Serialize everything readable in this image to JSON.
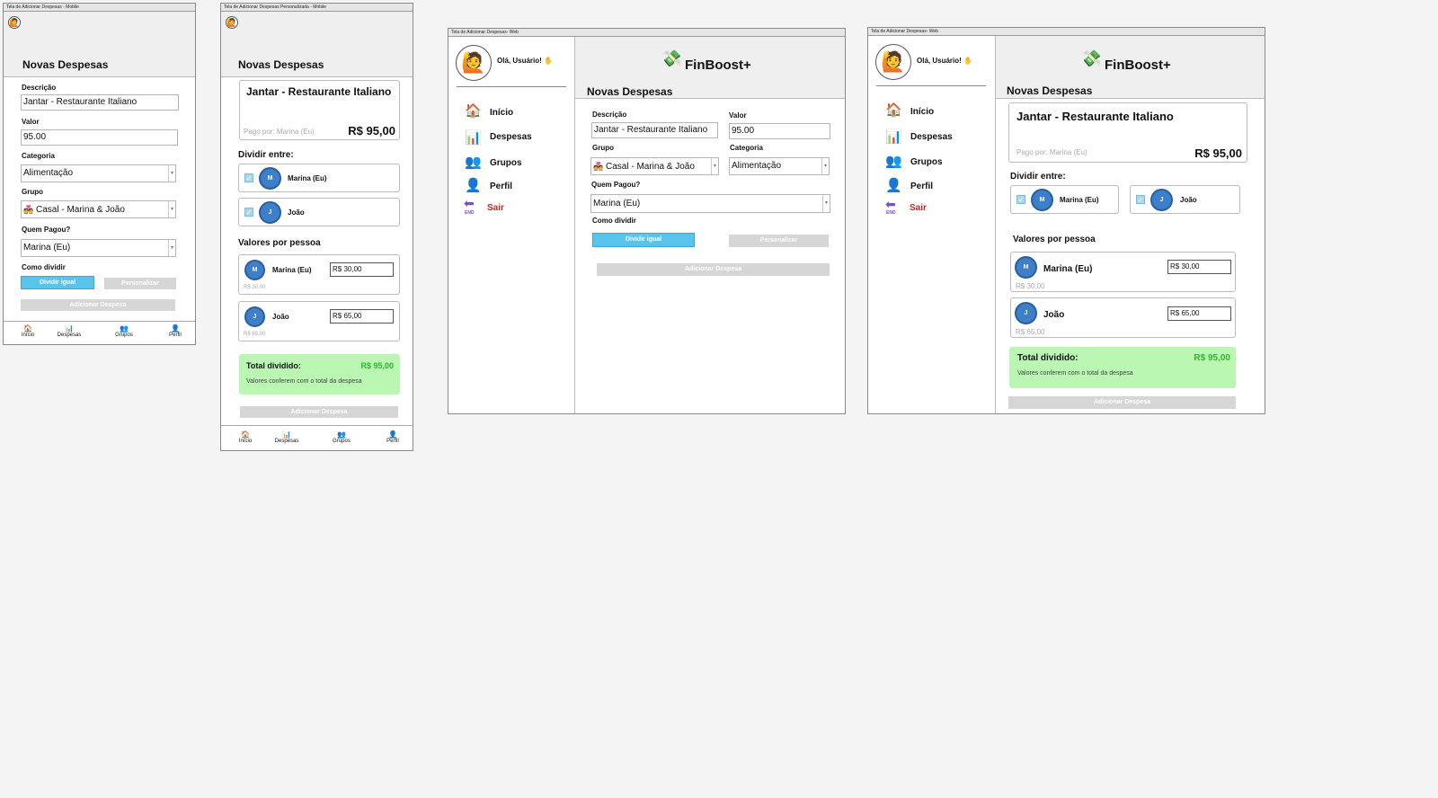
{
  "brand": {
    "name": "FinBoost+",
    "logo_icon": "money-hand-icon",
    "accent": "#58c4ec",
    "danger": "#cc2222",
    "success_bg": "#b9f7b2",
    "success_text": "#2fb52f"
  },
  "common": {
    "page_title": "Novas Despesas",
    "greeting": "Olá, Usuário! ✋",
    "label_descricao": "Descrição",
    "label_valor": "Valor",
    "label_categoria": "Categoria",
    "label_grupo": "Grupo",
    "label_quem_pagou": "Quem Pagou?",
    "label_como_dividir": "Como dividir",
    "value_descricao": "Jantar - Restaurante Italiano",
    "value_valor": "95.00",
    "value_categoria": "Alimentação",
    "value_grupo": "Casal - Marina & João",
    "value_quem_pagou": "Marina (Eu)",
    "btn_dividir_igual": "Dividir igual",
    "btn_personalizar": "Personalizar",
    "btn_adicionar": "Adicionar Despesa",
    "expense_title": "Jantar - Restaurante Italiano",
    "paid_by": "Pago por: Marina (Eu)",
    "amount": "R$ 95,00",
    "dividir_entre": "Dividir entre:",
    "valores_por_pessoa": "Valores por pessoa",
    "total_dividido": "Total dividido:",
    "total_value": "R$ 95,00",
    "total_msg": "Valores conferem com o total da despesa",
    "people": [
      {
        "initial": "M",
        "name": "Marina (Eu)",
        "value": "R$ 30,00",
        "hint": "R$ 30,00"
      },
      {
        "initial": "J",
        "name": "João",
        "value": "R$ 65,00",
        "hint": "R$ 65,00"
      }
    ]
  },
  "nav": {
    "inicio": "Início",
    "despesas": "Despesas",
    "grupos": "Grupos",
    "perfil": "Perfil",
    "sair": "Sair",
    "end_label": "END"
  },
  "frames": {
    "f1": "Tela de Adicionar Despesas - Mobile",
    "f2": "Tela de Adicionar Despesas Personalizada - Mobile",
    "f3": "Tela de Adicionar Despesas- Web",
    "f4": "Tela de Adicionar Despesas- Web"
  }
}
